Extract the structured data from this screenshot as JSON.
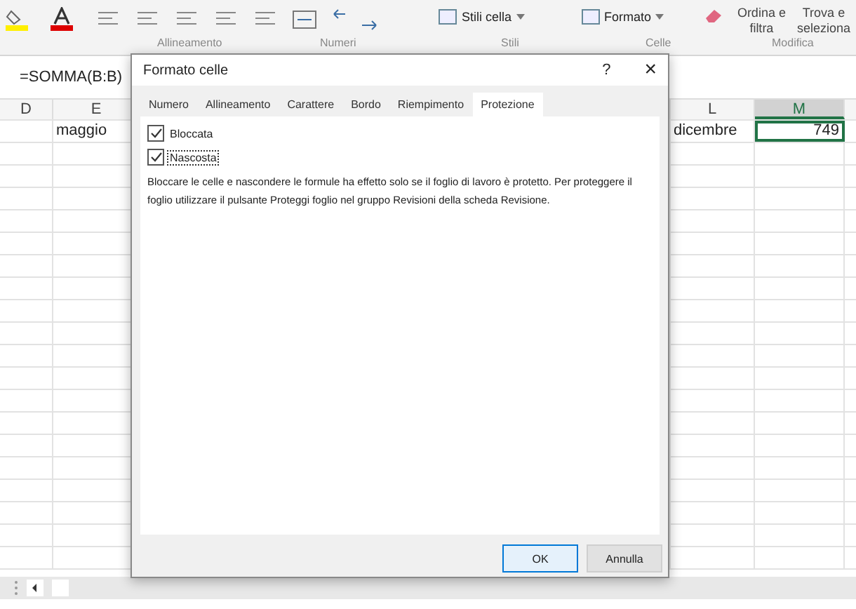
{
  "ribbon": {
    "tools": [
      {
        "label": "Stili cella",
        "dropdown": true
      },
      {
        "label": "Formato",
        "dropdown": true
      }
    ],
    "sort": {
      "line1": "Ordina e",
      "line2": "filtra"
    },
    "find": {
      "line1": "Trova e",
      "line2": "seleziona"
    },
    "groups": [
      "Allineamento",
      "Numeri",
      "Stili",
      "Celle",
      "Modifica"
    ]
  },
  "formula_bar": {
    "formula": "=SOMMA(B:B)"
  },
  "sheet": {
    "columns": [
      {
        "label": "D",
        "selected": false
      },
      {
        "label": "E",
        "selected": false
      },
      {
        "label": "L",
        "selected": false
      },
      {
        "label": "M",
        "selected": true
      }
    ],
    "rows": [
      [
        "",
        "maggio",
        "dicembre",
        "749"
      ]
    ]
  },
  "dialog": {
    "title": "Formato celle",
    "help": "?",
    "close": "×",
    "tabs": [
      {
        "label": "Numero",
        "selected": false
      },
      {
        "label": "Allineamento",
        "selected": false
      },
      {
        "label": "Carattere",
        "selected": false
      },
      {
        "label": "Bordo",
        "selected": false
      },
      {
        "label": "Riempimento",
        "selected": false
      },
      {
        "label": "Protezione",
        "selected": true
      }
    ],
    "checkboxes": [
      {
        "label": "Bloccata",
        "checked": true
      },
      {
        "label": "Nascosta",
        "checked": true
      }
    ],
    "description": "Bloccare le celle e nascondere le formule ha effetto solo se il foglio di lavoro è protetto. Per proteggere il foglio utilizzare il pulsante Proteggi foglio nel gruppo Revisioni della scheda Revisione.",
    "buttons": [
      {
        "label": "OK",
        "default": true
      },
      {
        "label": "Annulla",
        "default": false
      }
    ]
  }
}
